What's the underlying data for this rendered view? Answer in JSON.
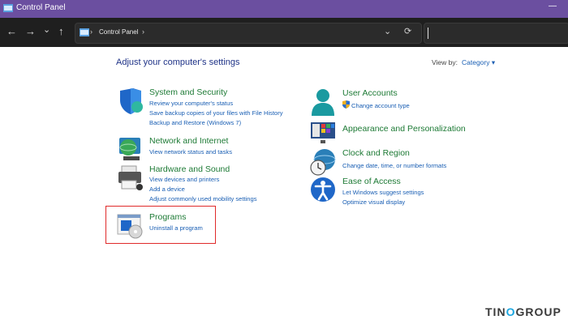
{
  "window": {
    "title": "Control Panel",
    "minimize_glyph": "—"
  },
  "nav": {
    "back": "←",
    "forward": "→",
    "recent": "⌄",
    "up": "↑"
  },
  "address": {
    "path": "Control Panel",
    "separator": "›",
    "dropdown": "⌄",
    "refresh": "⟳"
  },
  "main": {
    "heading": "Adjust your computer's settings",
    "view_by_label": "View by:",
    "view_by_value": "Category ▾"
  },
  "categories": {
    "system": {
      "title": "System and Security",
      "links": [
        "Review your computer's status",
        "Save backup copies of your files with File History",
        "Backup and Restore (Windows 7)"
      ]
    },
    "network": {
      "title": "Network and Internet",
      "links": [
        "View network status and tasks"
      ]
    },
    "hardware": {
      "title": "Hardware and Sound",
      "links": [
        "View devices and printers",
        "Add a device",
        "Adjust commonly used mobility settings"
      ]
    },
    "programs": {
      "title": "Programs",
      "links": [
        "Uninstall a program"
      ]
    },
    "user": {
      "title": "User Accounts",
      "links": [
        "Change account type"
      ]
    },
    "appearance": {
      "title": "Appearance and Personalization"
    },
    "clock": {
      "title": "Clock and Region",
      "links": [
        "Change date, time, or number formats"
      ]
    },
    "ease": {
      "title": "Ease of Access",
      "links": [
        "Let Windows suggest settings",
        "Optimize visual display"
      ]
    }
  },
  "watermark": {
    "part1": "TIN",
    "part2": "O",
    "part3": "GROUP"
  },
  "colors": {
    "titlebar": "#6b4fa0",
    "nav_bg": "#1f1f1f",
    "heading": "#1e3287",
    "category_title": "#1d7a35",
    "link": "#1a5fb4",
    "highlight": "#e02a2a"
  }
}
